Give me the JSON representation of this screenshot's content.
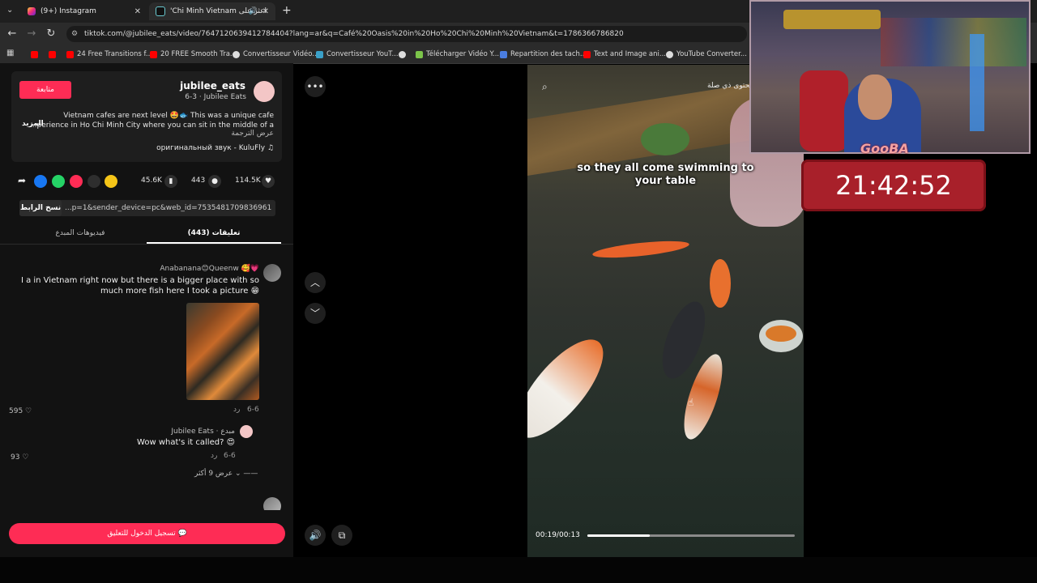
{
  "browser": {
    "tabs": [
      {
        "label": "(9+) Instagram",
        "icon": "instagram-icon"
      },
      {
        "label": "'Chi Minh Vietnam اعثر على",
        "icon": "tiktok-icon"
      }
    ],
    "new_tab": "+",
    "url": "tiktok.com/@jubilee_eats/video/7647120639412784404?lang=ar&q=Café%20Oasis%20in%20Ho%20Chi%20Minh%20Vietnam&t=1786366786820",
    "bookmarks": [
      "24 Free Transitions f...",
      "20 FREE Smooth Tra...",
      "Convertisseur Vidéo...",
      "Convertisseur YouT...",
      "Télécharger Vidéo Y...",
      "Repartition des tach...",
      "Text and Image ani...",
      "YouTube Converter..."
    ]
  },
  "post": {
    "follow_label": "متابعة",
    "username": "jubilee_eats",
    "subline": "6-3 · Jubilee Eats",
    "desc_line1": "Vietnam cafes are next level 🤩🐟 This was a unique cafe",
    "desc_line2": "...perience in Ho Chi Minh City where you can sit in the middle of a",
    "more_label": "المزيد",
    "translate_label": "عرض الترجمة",
    "sound": "оригинальный звук - KuluFly ♫",
    "stats": {
      "saves": "45.6K",
      "comments": "443",
      "likes": "114.5K"
    },
    "copy_link_label": "نسخ الرابط",
    "link_text": "...p=1&sender_device=pc&web_id=7535481709836961302"
  },
  "tabs": {
    "creator_videos": "فيديوهات المبدع",
    "comments": "(443) تعليقات"
  },
  "comments": [
    {
      "name": "Anabanana😊Queenw 🥰💗",
      "line1": "I a in Vietnam right now but there is a bigger place with so",
      "line2": "much more fish here I took a picture 😁",
      "date": "6-6",
      "reply": "رد",
      "likes": "595 ♡"
    },
    {
      "name": "Jubilee Eats · مبدع",
      "line1": "Wow what's it called? 😍",
      "date": "6-6",
      "reply": "رد",
      "likes": "93 ♡",
      "view_more": "عرض 9 أكثر ⌄ ——"
    }
  ],
  "login_button": "تسجيل الدخول للتعليق 💬",
  "video": {
    "subtitle_line1": "so they all come swimming to",
    "subtitle_line2": "your table",
    "search_hint": "محتوى ذي صلة",
    "time": "00:19/00:13",
    "progress": 0.3
  },
  "overlay": {
    "banner_text": "GooBA",
    "timer": "21:42:52"
  }
}
